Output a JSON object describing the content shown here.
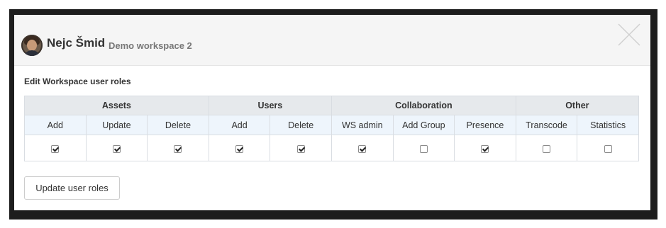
{
  "header": {
    "user_name": "Nejc Šmid",
    "workspace": "Demo workspace 2"
  },
  "section_title": "Edit Workspace user roles",
  "groups": [
    "Assets",
    "Users",
    "Collaboration",
    "Other"
  ],
  "columns": [
    "Add",
    "Update",
    "Delete",
    "Add",
    "Delete",
    "WS admin",
    "Add Group",
    "Presence",
    "Transcode",
    "Statistics"
  ],
  "checked": [
    true,
    true,
    true,
    true,
    true,
    true,
    false,
    true,
    false,
    false
  ],
  "update_button": "Update user roles"
}
